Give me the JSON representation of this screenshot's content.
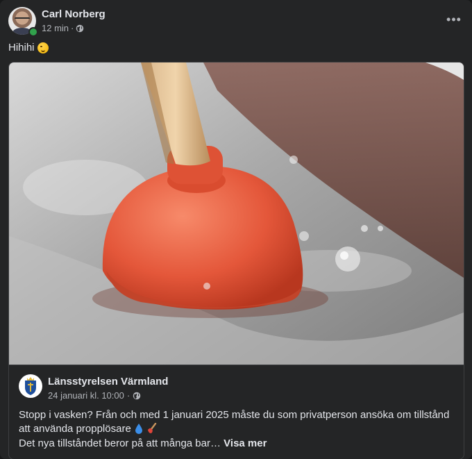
{
  "post": {
    "author": "Carl Norberg",
    "time": "12 min",
    "separator": "·",
    "privacy_icon": "globe-icon",
    "more_icon": "more-icon",
    "more_label": "•••",
    "text": "Hihihi",
    "emoji": "winking-face-emoji"
  },
  "shared": {
    "image_subject": "plunger-in-sink-photo",
    "page_name": "Länsstyrelsen Värmland",
    "page_time": "24 januari kl. 10:00",
    "separator": "·",
    "body": "Stopp i vasken? Från och med 1 januari 2025 måste du som privatperson ansöka om tillstånd att använda propplösare",
    "body_icons": [
      "droplet-emoji",
      "plunger-emoji"
    ],
    "preview": "Det nya tillståndet beror på att många bar…",
    "see_more": "Visa mer"
  },
  "colors": {
    "background": "#242526",
    "text": "#e4e6eb",
    "secondary_text": "#b0b3b8",
    "online": "#31a24c",
    "plunger": "#e4573a"
  }
}
